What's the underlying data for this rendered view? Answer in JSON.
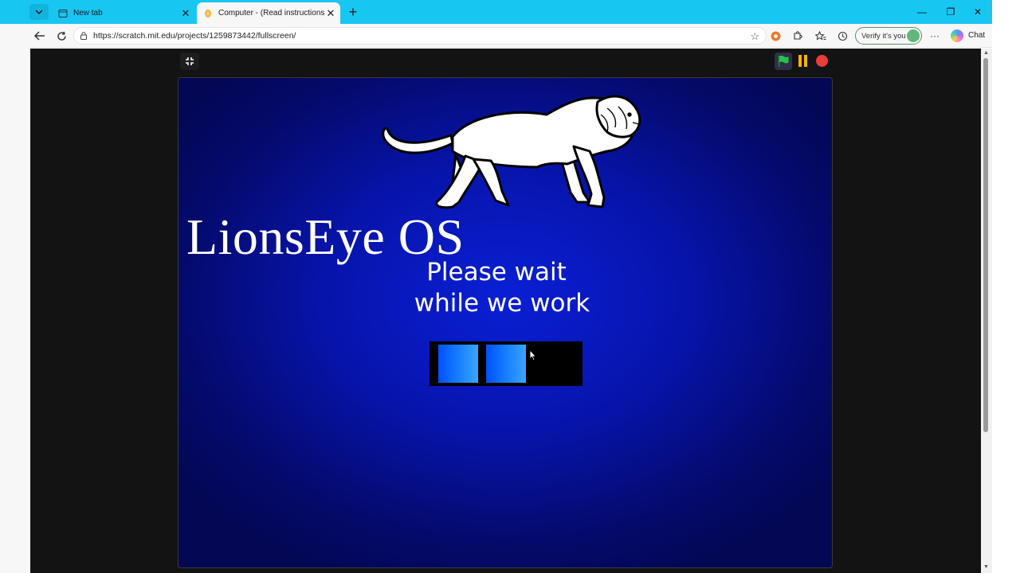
{
  "browser": {
    "tabs": [
      {
        "label": "New tab",
        "active": false,
        "icon": "newtab-icon"
      },
      {
        "label": "Computer - (Read instructions and",
        "active": true,
        "icon": "scratch-icon"
      }
    ],
    "new_tab_symbol": "+",
    "window_controls": {
      "minimize": "—",
      "restore": "❐",
      "close": "✕"
    },
    "address": {
      "url": "https://scratch.mit.edu/projects/1259873442/fullscreen/"
    },
    "profile": {
      "verify_label": "Verify it's you"
    },
    "more_symbol": "···",
    "chat_label": "Chat"
  },
  "player": {
    "controls": [
      "exit-fullscreen-icon",
      "green-flag-icon",
      "pause-icon",
      "stop-icon"
    ],
    "colors": {
      "flag": "#27c24c",
      "pause": "#ffb400",
      "stop": "#ec3b3b"
    }
  },
  "stage": {
    "title": "LionsEye OS",
    "message_line1": "Please wait",
    "message_line2": "while we work",
    "loader": {
      "filled_blocks": 2,
      "total_blocks": 3
    },
    "colors": {
      "background_center": "#0a1fd6",
      "background_edge": "#030754",
      "loader_block": "#1c86ff"
    }
  }
}
